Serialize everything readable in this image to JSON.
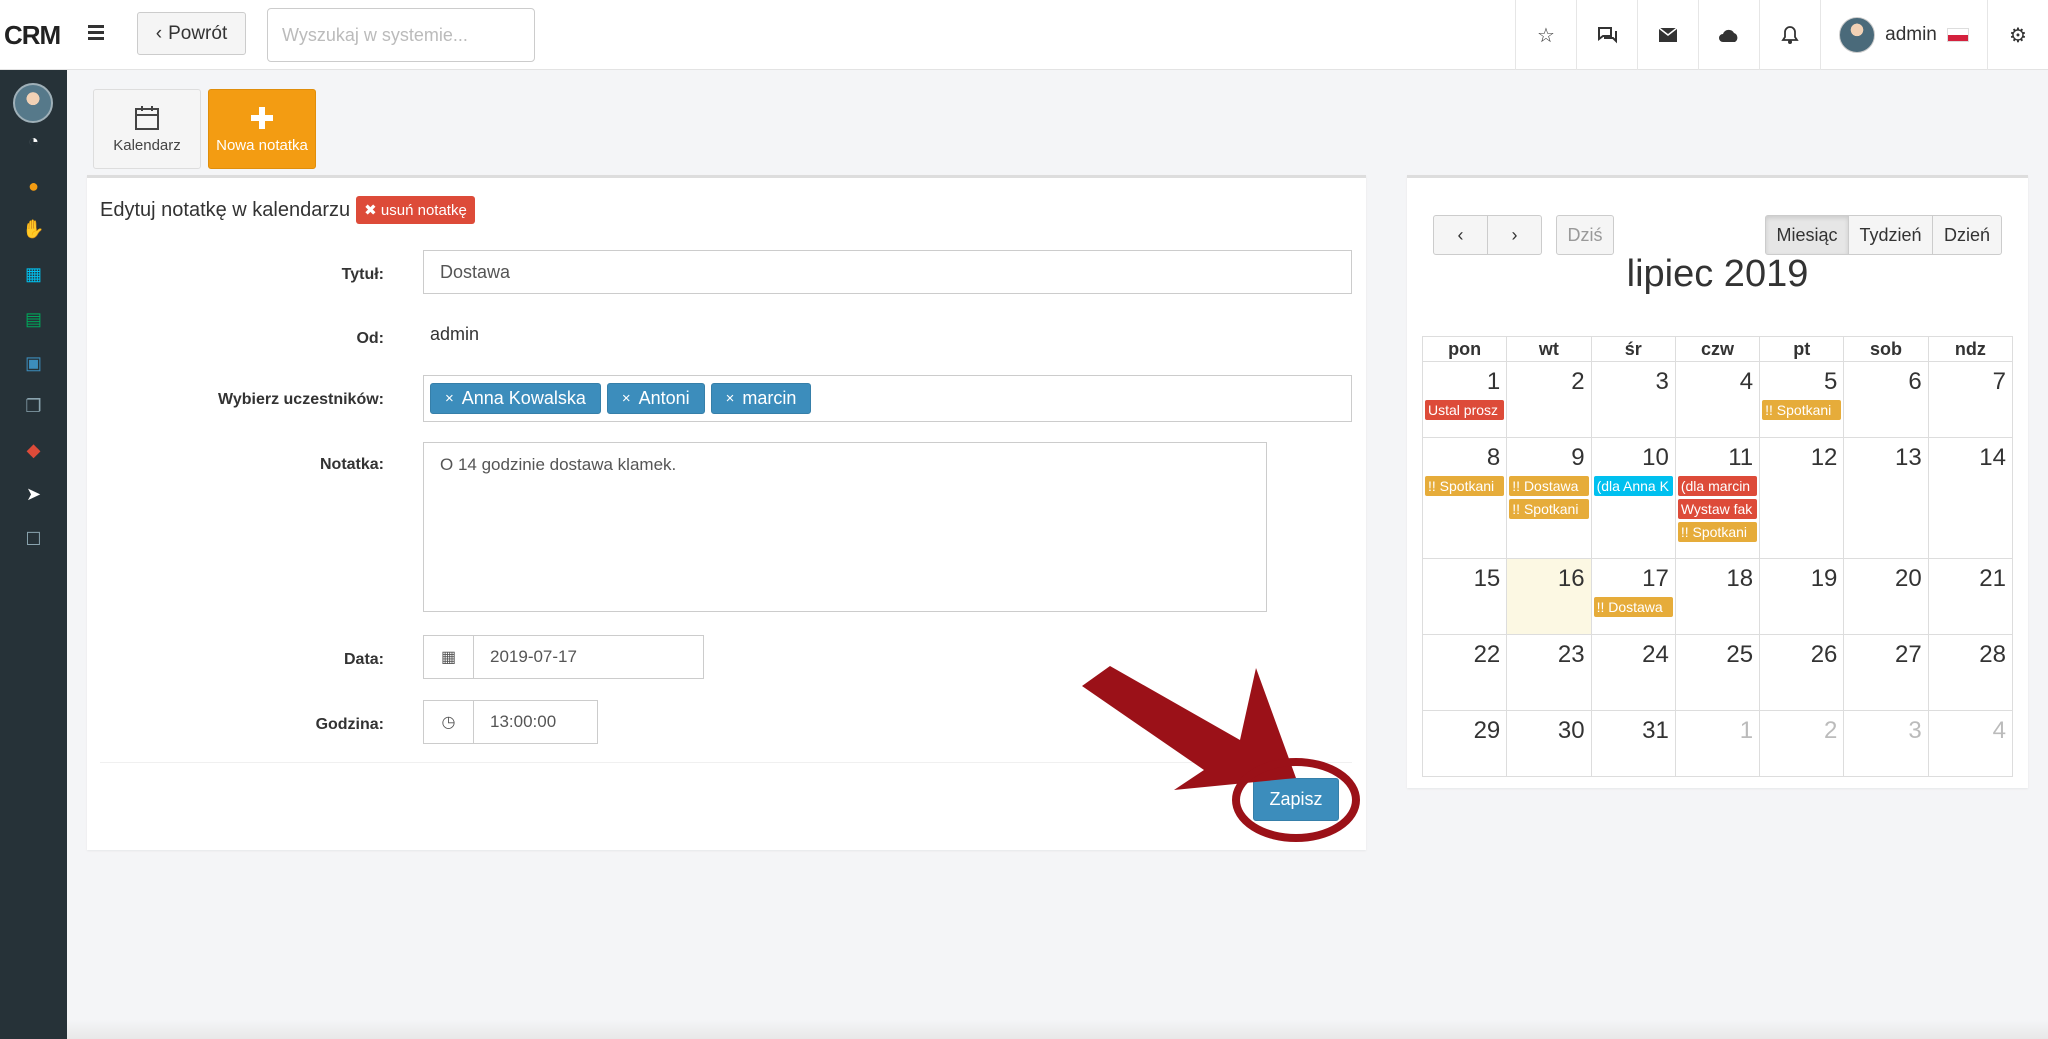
{
  "brand": "CRM",
  "topbar": {
    "back_label": "Powrót",
    "search_placeholder": "Wyszukaj w systemie...",
    "user_name": "admin"
  },
  "toolbar": {
    "calendar_label": "Kalendarz",
    "new_note_label": "Nowa notatka"
  },
  "form": {
    "header": "Edytuj notatkę w kalendarzu",
    "delete_label": "usuń notatkę",
    "title_label": "Tytuł:",
    "title_value": "Dostawa",
    "from_label": "Od:",
    "from_value": "admin",
    "participants_label": "Wybierz uczestników:",
    "participants": [
      "Anna Kowalska",
      "Antoni",
      "marcin"
    ],
    "note_label": "Notatka:",
    "note_value": "O 14 godzinie dostawa klamek.",
    "date_label": "Data:",
    "date_value": "2019-07-17",
    "time_label": "Godzina:",
    "time_value": "13:00:00",
    "save_label": "Zapisz"
  },
  "calendar": {
    "today_label": "Dziś",
    "view_month": "Miesiąc",
    "view_week": "Tydzień",
    "view_day": "Dzień",
    "title": "lipiec 2019",
    "weekdays": [
      "pon",
      "wt",
      "śr",
      "czw",
      "pt",
      "sob",
      "ndz"
    ],
    "weeks": [
      [
        {
          "d": "1",
          "ev": [
            {
              "t": "Ustal prosz",
              "c": "red"
            }
          ]
        },
        {
          "d": "2"
        },
        {
          "d": "3"
        },
        {
          "d": "4"
        },
        {
          "d": "5",
          "ev": [
            {
              "t": "!! Spotkani",
              "c": "orange"
            }
          ]
        },
        {
          "d": "6"
        },
        {
          "d": "7"
        }
      ],
      [
        {
          "d": "8",
          "ev": [
            {
              "t": "!! Spotkani",
              "c": "orange"
            }
          ]
        },
        {
          "d": "9",
          "ev": [
            {
              "t": "!! Dostawa",
              "c": "orange"
            },
            {
              "t": "!! Spotkani",
              "c": "orange"
            }
          ]
        },
        {
          "d": "10",
          "ev": [
            {
              "t": "(dla Anna K",
              "c": "blue"
            }
          ]
        },
        {
          "d": "11",
          "ev": [
            {
              "t": "(dla marcin",
              "c": "red"
            },
            {
              "t": "Wystaw fak",
              "c": "red"
            },
            {
              "t": "!! Spotkani",
              "c": "orange"
            }
          ]
        },
        {
          "d": "12"
        },
        {
          "d": "13"
        },
        {
          "d": "14"
        }
      ],
      [
        {
          "d": "15"
        },
        {
          "d": "16",
          "today": true
        },
        {
          "d": "17",
          "ev": [
            {
              "t": "!! Dostawa",
              "c": "orange"
            }
          ]
        },
        {
          "d": "18"
        },
        {
          "d": "19"
        },
        {
          "d": "20"
        },
        {
          "d": "21"
        }
      ],
      [
        {
          "d": "22"
        },
        {
          "d": "23"
        },
        {
          "d": "24"
        },
        {
          "d": "25"
        },
        {
          "d": "26"
        },
        {
          "d": "27"
        },
        {
          "d": "28"
        }
      ],
      [
        {
          "d": "29"
        },
        {
          "d": "30"
        },
        {
          "d": "31"
        },
        {
          "d": "1",
          "other": true
        },
        {
          "d": "2",
          "other": true
        },
        {
          "d": "3",
          "other": true
        },
        {
          "d": "4",
          "other": true
        }
      ]
    ]
  },
  "sidebar_icons": [
    {
      "name": "dashboard-icon",
      "glyph": "◔",
      "color": "#ffffff"
    },
    {
      "name": "users-icon",
      "glyph": "●",
      "color": "#f39c12"
    },
    {
      "name": "handshake-icon",
      "glyph": "✋",
      "color": "#39cccc"
    },
    {
      "name": "calendar-icon",
      "glyph": "▦",
      "color": "#00c0ef"
    },
    {
      "name": "document-icon",
      "glyph": "▤",
      "color": "#00a65a"
    },
    {
      "name": "pdf-icon",
      "glyph": "▣",
      "color": "#3c8dbc"
    },
    {
      "name": "copy-icon",
      "glyph": "❐",
      "color": "#8aa4af"
    },
    {
      "name": "ticket-icon",
      "glyph": "◆",
      "color": "#dd4b39"
    },
    {
      "name": "send-icon",
      "glyph": "➤",
      "color": "#ffffff"
    },
    {
      "name": "note-icon",
      "glyph": "☐",
      "color": "#8aa4af"
    }
  ]
}
